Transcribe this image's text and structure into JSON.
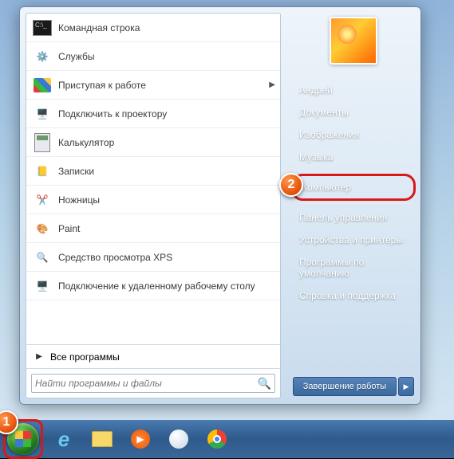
{
  "programs": [
    {
      "label": "Командная строка",
      "icon": "cmd",
      "submenu": false
    },
    {
      "label": "Службы",
      "icon": "gear",
      "submenu": false
    },
    {
      "label": "Приступая к работе",
      "icon": "flag",
      "submenu": true
    },
    {
      "label": "Подключить к проектору",
      "icon": "proj",
      "submenu": false
    },
    {
      "label": "Калькулятор",
      "icon": "calc",
      "submenu": false
    },
    {
      "label": "Записки",
      "icon": "notes",
      "submenu": false
    },
    {
      "label": "Ножницы",
      "icon": "scissors",
      "submenu": false
    },
    {
      "label": "Paint",
      "icon": "paint",
      "submenu": false
    },
    {
      "label": "Средство просмотра XPS",
      "icon": "xps",
      "submenu": false
    },
    {
      "label": "Подключение к удаленному рабочему столу",
      "icon": "rdp",
      "submenu": false
    }
  ],
  "all_programs": "Все программы",
  "search": {
    "placeholder": "Найти программы и файлы"
  },
  "right_items": [
    {
      "label": "Андрей",
      "sep": false,
      "hl": false
    },
    {
      "label": "Документы",
      "sep": false,
      "hl": false
    },
    {
      "label": "Изображения",
      "sep": false,
      "hl": false
    },
    {
      "label": "Музыка",
      "sep": true,
      "hl": false
    },
    {
      "label": "Компьютер",
      "sep": true,
      "hl": true
    },
    {
      "label": "Панель управления",
      "sep": false,
      "hl": false
    },
    {
      "label": "Устройства и принтеры",
      "sep": false,
      "hl": false
    },
    {
      "label": "Программы по умолчанию",
      "sep": false,
      "hl": false
    },
    {
      "label": "Справка и поддержка",
      "sep": false,
      "hl": false
    }
  ],
  "shutdown": "Завершение работы",
  "callouts": {
    "start": "1",
    "computer": "2"
  }
}
